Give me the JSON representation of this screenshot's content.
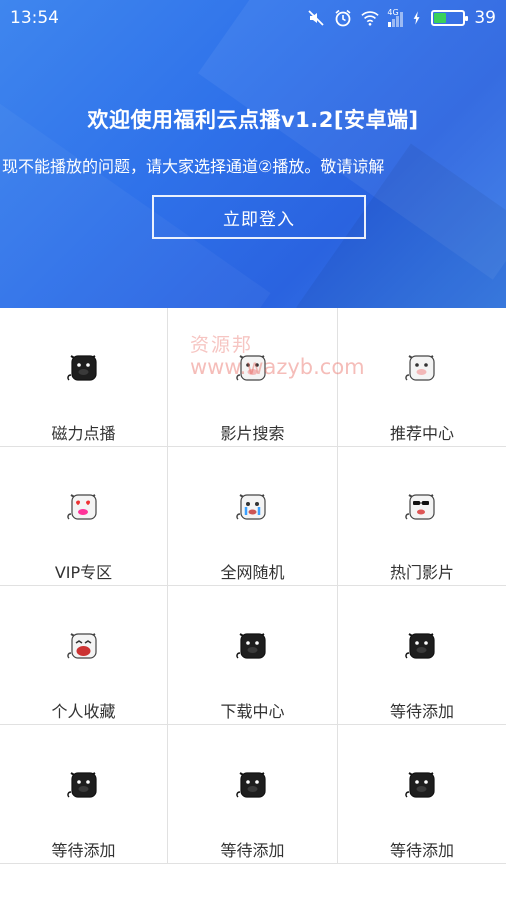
{
  "status_bar": {
    "time": "13:54",
    "network": "4G",
    "battery_level": "39",
    "battery_fraction": 0.39
  },
  "hero": {
    "title": "欢迎使用福利云点播v1.2[安卓端]",
    "notice": "现不能播放的问题，请大家选择通道②播放。敬请谅解",
    "login_label": "立即登入"
  },
  "grid": {
    "items": [
      {
        "label": "磁力点播",
        "icon": "cow-black-icon"
      },
      {
        "label": "影片搜索",
        "icon": "cow-white-icon"
      },
      {
        "label": "推荐中心",
        "icon": "cow-white-icon"
      },
      {
        "label": "VIP专区",
        "icon": "cow-heart-eyes-icon"
      },
      {
        "label": "全网随机",
        "icon": "cow-crying-icon"
      },
      {
        "label": "热门影片",
        "icon": "cow-sunglasses-icon"
      },
      {
        "label": "个人收藏",
        "icon": "cow-laughing-icon"
      },
      {
        "label": "下载中心",
        "icon": "cow-black-icon"
      },
      {
        "label": "等待添加",
        "icon": "cow-black-icon"
      },
      {
        "label": "等待添加",
        "icon": "cow-black-icon"
      },
      {
        "label": "等待添加",
        "icon": "cow-black-icon"
      },
      {
        "label": "等待添加",
        "icon": "cow-black-icon"
      }
    ]
  },
  "watermark": {
    "text_cn": "资源邦",
    "text_en": "www.wazyb.com"
  },
  "colors": {
    "hero_blue": "#2f72ea",
    "battery_green": "#3ad05a",
    "grid_line": "#e1e1e1"
  }
}
